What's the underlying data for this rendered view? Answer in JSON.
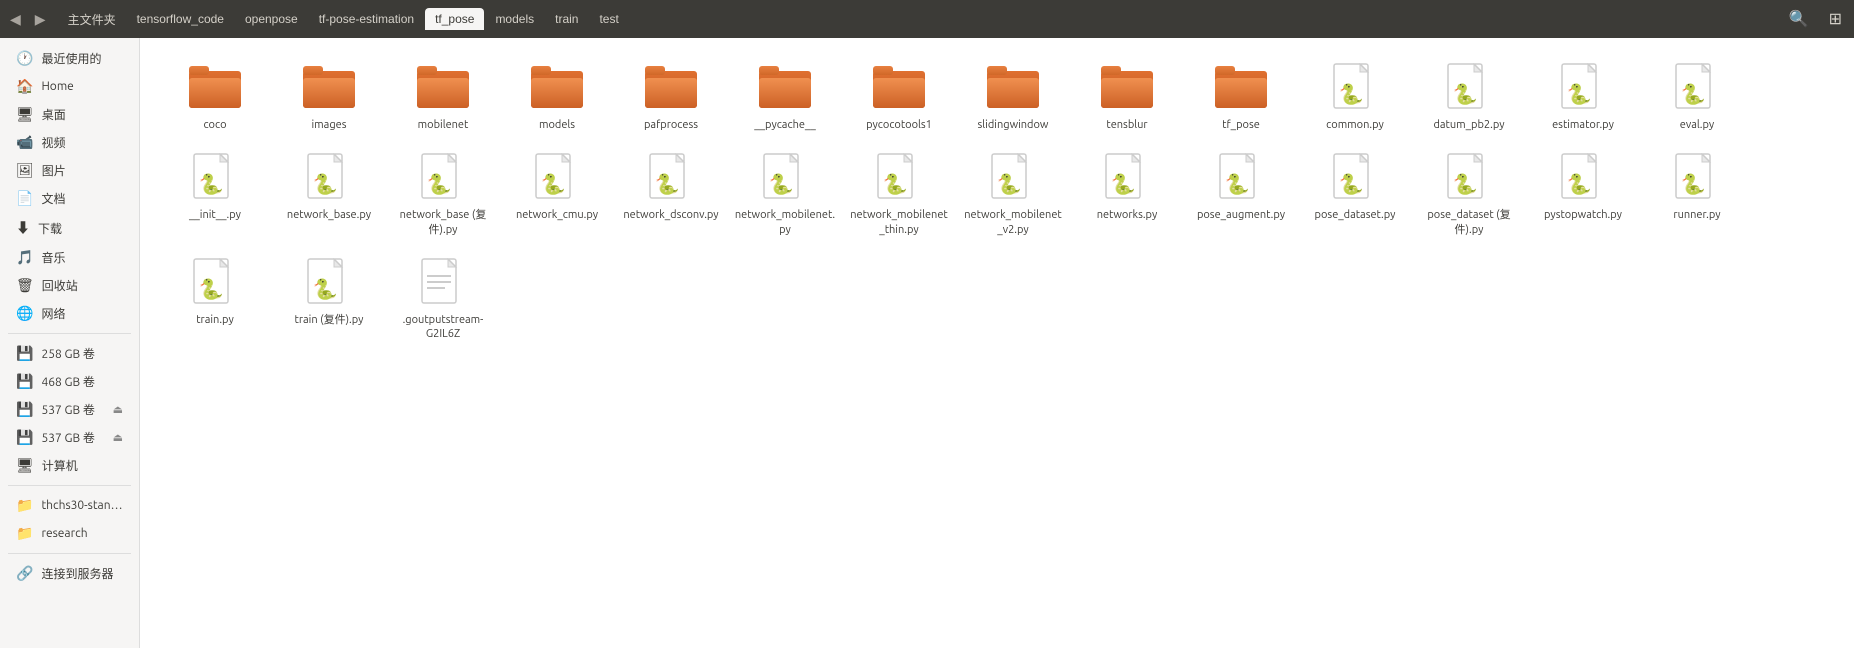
{
  "topbar": {
    "nav_back_label": "◀",
    "nav_forward_label": "▶",
    "breadcrumbs": [
      {
        "id": "home",
        "label": "主文件夹",
        "active": false
      },
      {
        "id": "tensorflow_code",
        "label": "tensorflow_code",
        "active": false
      },
      {
        "id": "openpose",
        "label": "openpose",
        "active": false
      },
      {
        "id": "tf_pose_estimation",
        "label": "tf-pose-estimation",
        "active": false
      },
      {
        "id": "tf_pose",
        "label": "tf_pose",
        "active": true
      },
      {
        "id": "models",
        "label": "models",
        "active": false
      },
      {
        "id": "train",
        "label": "train",
        "active": false
      },
      {
        "id": "test",
        "label": "test",
        "active": false
      }
    ],
    "search_icon": "🔍",
    "grid_icon": "⊞"
  },
  "sidebar": {
    "items": [
      {
        "id": "recent",
        "label": "最近使用的",
        "icon": "🕐",
        "type": "item"
      },
      {
        "id": "home",
        "label": "Home",
        "icon": "🏠",
        "type": "item"
      },
      {
        "id": "desktop",
        "label": "桌面",
        "icon": "🖥",
        "type": "item"
      },
      {
        "id": "video",
        "label": "视频",
        "icon": "📹",
        "type": "item"
      },
      {
        "id": "picture",
        "label": "图片",
        "icon": "🖼",
        "type": "item"
      },
      {
        "id": "document",
        "label": "文档",
        "icon": "📄",
        "type": "item"
      },
      {
        "id": "download",
        "label": "下载",
        "icon": "⬇",
        "type": "item"
      },
      {
        "id": "music",
        "label": "音乐",
        "icon": "🎵",
        "type": "item"
      },
      {
        "id": "trash",
        "label": "回收站",
        "icon": "🗑",
        "type": "item"
      },
      {
        "id": "network",
        "label": "网络",
        "icon": "🌐",
        "type": "item"
      },
      {
        "id": "divider1",
        "type": "divider"
      },
      {
        "id": "vol258",
        "label": "258 GB 卷",
        "icon": "💾",
        "type": "item"
      },
      {
        "id": "vol468",
        "label": "468 GB 卷",
        "icon": "💾",
        "type": "item"
      },
      {
        "id": "vol537a",
        "label": "537 GB 卷",
        "icon": "💾",
        "type": "item",
        "eject": true
      },
      {
        "id": "vol537b",
        "label": "537 GB 卷",
        "icon": "💾",
        "type": "item",
        "eject": true
      },
      {
        "id": "computer",
        "label": "计算机",
        "icon": "🖥",
        "type": "item"
      },
      {
        "id": "divider2",
        "type": "divider"
      },
      {
        "id": "thchs30",
        "label": "thchs30-stand...",
        "icon": "📁",
        "type": "item"
      },
      {
        "id": "research",
        "label": "research",
        "icon": "📁",
        "type": "item"
      },
      {
        "id": "divider3",
        "type": "divider"
      },
      {
        "id": "connect",
        "label": "连接到服务器",
        "icon": "🔗",
        "type": "item"
      }
    ]
  },
  "files": {
    "folders": [
      {
        "id": "coco",
        "name": "coco"
      },
      {
        "id": "images",
        "name": "images"
      },
      {
        "id": "mobilenet",
        "name": "mobilenet"
      },
      {
        "id": "models",
        "name": "models"
      },
      {
        "id": "pafprocess",
        "name": "pafprocess"
      },
      {
        "id": "pycache",
        "name": "__pycache__"
      },
      {
        "id": "pycocotools1",
        "name": "pycocotools1"
      },
      {
        "id": "slidingwindow",
        "name": "slidingwindow"
      },
      {
        "id": "tensblur",
        "name": "tensblur"
      },
      {
        "id": "tf_pose",
        "name": "tf_pose"
      }
    ],
    "pyfiles": [
      {
        "id": "common",
        "name": "common.py"
      },
      {
        "id": "datum_pb2",
        "name": "datum_pb2.py"
      },
      {
        "id": "estimator",
        "name": "estimator.py"
      },
      {
        "id": "eval",
        "name": "eval.py"
      },
      {
        "id": "init",
        "name": "__init__.py"
      },
      {
        "id": "network_base",
        "name": "network_base.py"
      },
      {
        "id": "network_base_copy",
        "name": "network_base (复件).py"
      },
      {
        "id": "network_cmu",
        "name": "network_cmu.py"
      },
      {
        "id": "network_dsconv",
        "name": "network_dsconv.py"
      },
      {
        "id": "network_mobilenet",
        "name": "network_mobilenet.py"
      },
      {
        "id": "network_mobilenet_thin",
        "name": "network_mobilenet_thin.py"
      },
      {
        "id": "network_mobilenet_v2",
        "name": "network_mobilenet_v2.py"
      },
      {
        "id": "networks",
        "name": "networks.py"
      },
      {
        "id": "pose_augment",
        "name": "pose_augment.py"
      },
      {
        "id": "pose_dataset",
        "name": "pose_dataset.py"
      },
      {
        "id": "pose_dataset_copy",
        "name": "pose_dataset (复件).py"
      },
      {
        "id": "pystopwatch",
        "name": "pystopwatch.py"
      },
      {
        "id": "runner",
        "name": "runner.py"
      },
      {
        "id": "train",
        "name": "train.py"
      },
      {
        "id": "train_copy",
        "name": "train (复件).py"
      }
    ],
    "otherfiles": [
      {
        "id": "goutputstream",
        "name": ".goutputstream-G2IL6Z",
        "type": "text"
      }
    ]
  }
}
